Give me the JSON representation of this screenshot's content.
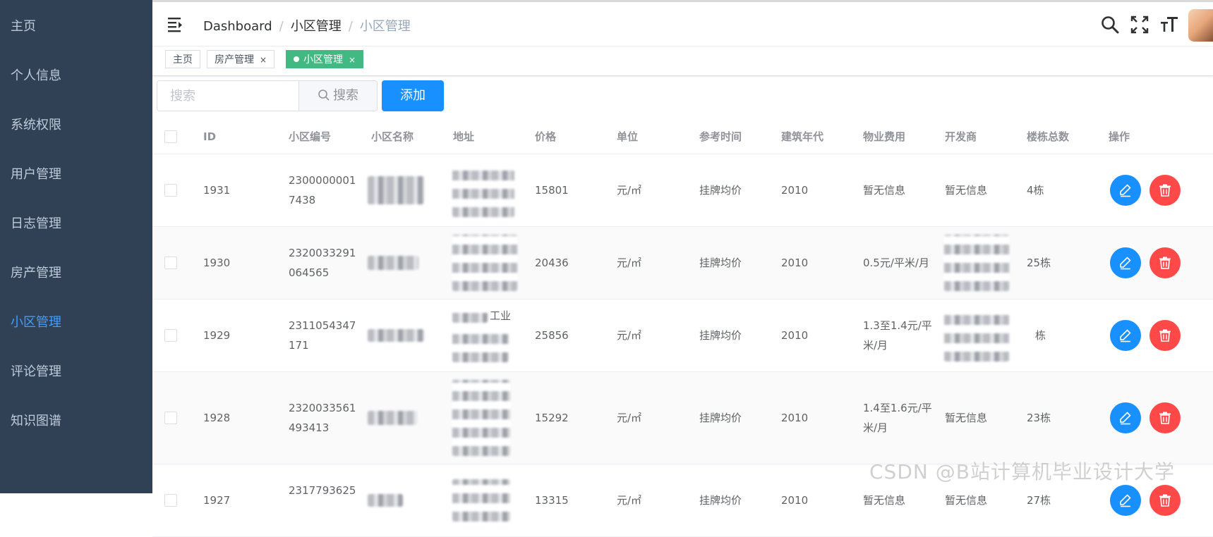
{
  "sidebar": {
    "items": [
      {
        "label": "主页"
      },
      {
        "label": "个人信息"
      },
      {
        "label": "系统权限"
      },
      {
        "label": "用户管理"
      },
      {
        "label": "日志管理"
      },
      {
        "label": "房产管理"
      },
      {
        "label": "小区管理",
        "active": true
      },
      {
        "label": "评论管理"
      },
      {
        "label": "知识图谱"
      }
    ]
  },
  "breadcrumb": [
    "Dashboard",
    "小区管理",
    "小区管理"
  ],
  "tags": [
    {
      "label": "主页"
    },
    {
      "label": "房产管理",
      "close": "×"
    },
    {
      "label": "小区管理",
      "close": "×",
      "active": true
    }
  ],
  "toolbar": {
    "search_placeholder": "搜索",
    "search_label": "搜索",
    "add_label": "添加"
  },
  "table": {
    "headers": [
      "ID",
      "小区编号",
      "小区名称",
      "地址",
      "价格",
      "单位",
      "参考时间",
      "建筑年代",
      "物业费用",
      "开发商",
      "楼栋总数",
      "操作"
    ],
    "rows": [
      {
        "id": "1931",
        "code": "23000000017438",
        "name": "",
        "address": "",
        "price": "15801",
        "unit": "元/㎡",
        "ref_time": "挂牌均价",
        "year": "2010",
        "fee": "暂无信息",
        "developer": "暂无信息",
        "buildings": "4栋"
      },
      {
        "id": "1930",
        "code": "2320033291064565",
        "name": "",
        "address": "",
        "price": "20436",
        "unit": "元/㎡",
        "ref_time": "挂牌均价",
        "year": "2010",
        "fee": "0.5元/平米/月",
        "developer": "",
        "buildings": "25栋"
      },
      {
        "id": "1929",
        "code": "2311054347171",
        "name": "",
        "address": "工业",
        "price": "25856",
        "unit": "元/㎡",
        "ref_time": "挂牌均价",
        "year": "2010",
        "fee": "1.3至1.4元/平米/月",
        "developer": "",
        "buildings": "栋"
      },
      {
        "id": "1928",
        "code": "2320033561493413",
        "name": "",
        "address": "",
        "price": "15292",
        "unit": "元/㎡",
        "ref_time": "挂牌均价",
        "year": "2010",
        "fee": "1.4至1.6元/平米/月",
        "developer": "暂无信息",
        "buildings": "23栋"
      },
      {
        "id": "1927",
        "code": "2317793625",
        "name": "",
        "address": "",
        "price": "13315",
        "unit": "元/㎡",
        "ref_time": "挂牌均价",
        "year": "2010",
        "fee": "暂无信息",
        "developer": "暂无信息",
        "buildings": "27栋"
      }
    ]
  },
  "watermark": "CSDN @B站计算机毕业设计大学",
  "colors": {
    "sidebar_bg": "#304156",
    "accent": "#1890ff",
    "danger": "#ff4949",
    "active_tag": "#42b983"
  },
  "icons": [
    "hamburger-icon",
    "search-icon",
    "fullscreen-icon",
    "text-size-icon",
    "edit-icon",
    "delete-icon",
    "close-icon"
  ]
}
